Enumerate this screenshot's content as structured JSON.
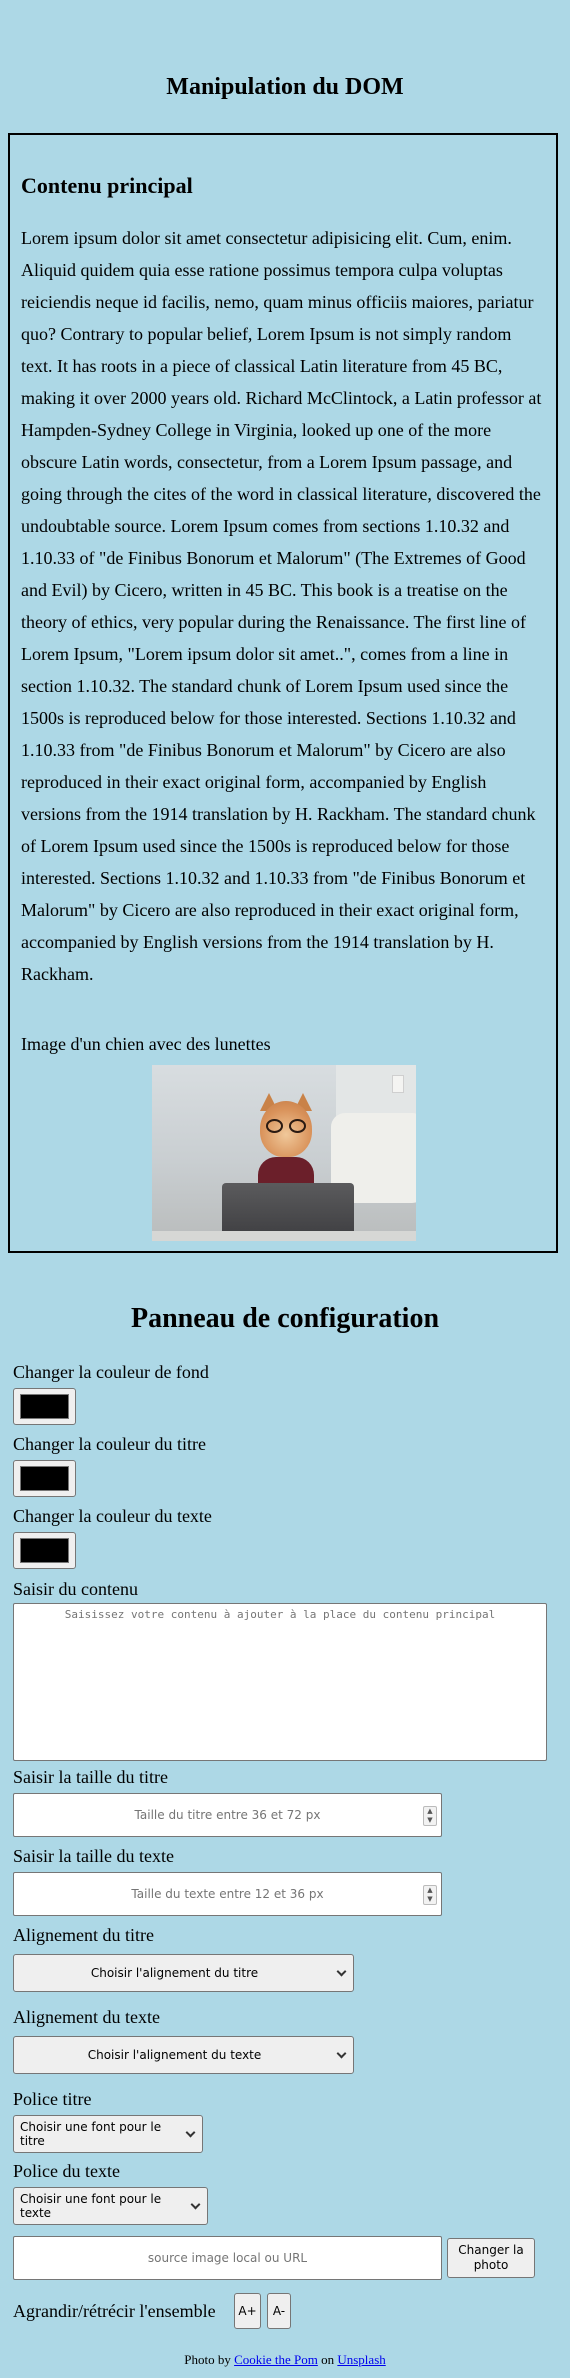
{
  "page": {
    "title": "Manipulation du DOM"
  },
  "main": {
    "heading": "Contenu principal",
    "text": "Lorem ipsum dolor sit amet consectetur adipisicing elit. Cum, enim. Aliquid quidem quia esse ratione possimus tempora culpa voluptas reiciendis neque id facilis, nemo, quam minus officiis maiores, pariatur quo? Contrary to popular belief, Lorem Ipsum is not simply random text. It has roots in a piece of classical Latin literature from 45 BC, making it over 2000 years old. Richard McClintock, a Latin professor at Hampden-Sydney College in Virginia, looked up one of the more obscure Latin words, consectetur, from a Lorem Ipsum passage, and going through the cites of the word in classical literature, discovered the undoubtable source. Lorem Ipsum comes from sections 1.10.32 and 1.10.33 of \"de Finibus Bonorum et Malorum\" (The Extremes of Good and Evil) by Cicero, written in 45 BC. This book is a treatise on the theory of ethics, very popular during the Renaissance. The first line of Lorem Ipsum, \"Lorem ipsum dolor sit amet..\", comes from a line in section 1.10.32. The standard chunk of Lorem Ipsum used since the 1500s is reproduced below for those interested. Sections 1.10.32 and 1.10.33 from \"de Finibus Bonorum et Malorum\" by Cicero are also reproduced in their exact original form, accompanied by English versions from the 1914 translation by H. Rackham. The standard chunk of Lorem Ipsum used since the 1500s is reproduced below for those interested. Sections 1.10.32 and 1.10.33 from \"de Finibus Bonorum et Malorum\" by Cicero are also reproduced in their exact original form, accompanied by English versions from the 1914 translation by H. Rackham.",
    "image_caption": "Image d'un chien avec des lunettes"
  },
  "config": {
    "title": "Panneau de configuration",
    "bg_color_label": "Changer la couleur de fond",
    "title_color_label": "Changer la couleur du titre",
    "text_color_label": "Changer la couleur du texte",
    "color_values": {
      "background": "#000000",
      "title": "#000000",
      "text": "#000000"
    },
    "content_label": "Saisir du contenu",
    "content_placeholder": "Saisissez votre contenu à ajouter à la place du contenu principal",
    "title_size_label": "Saisir la taille du titre",
    "title_size_placeholder": "Taille du titre entre 36 et 72 px",
    "text_size_label": "Saisir la taille du texte",
    "text_size_placeholder": "Taille du texte entre 12 et 36 px",
    "title_align_label": "Alignement du titre",
    "title_align_select": "Choisir l'alignement du titre",
    "text_align_label": "Alignement du texte",
    "text_align_select": "Choisir l'alignement du texte",
    "title_font_label": "Police titre",
    "title_font_select": "Choisir une font pour le titre",
    "text_font_label": "Police du texte",
    "text_font_select": "Choisir une font pour le texte",
    "image_src_placeholder": "source image local ou URL",
    "change_photo_button": "Changer la photo",
    "scale_label": "Agrandir/rétrécir l'ensemble",
    "scale_up_button": "A+",
    "scale_down_button": "A-"
  },
  "footer": {
    "prefix": "Photo by",
    "author": "Cookie the Pom",
    "middle": "on",
    "site": "Unsplash"
  }
}
